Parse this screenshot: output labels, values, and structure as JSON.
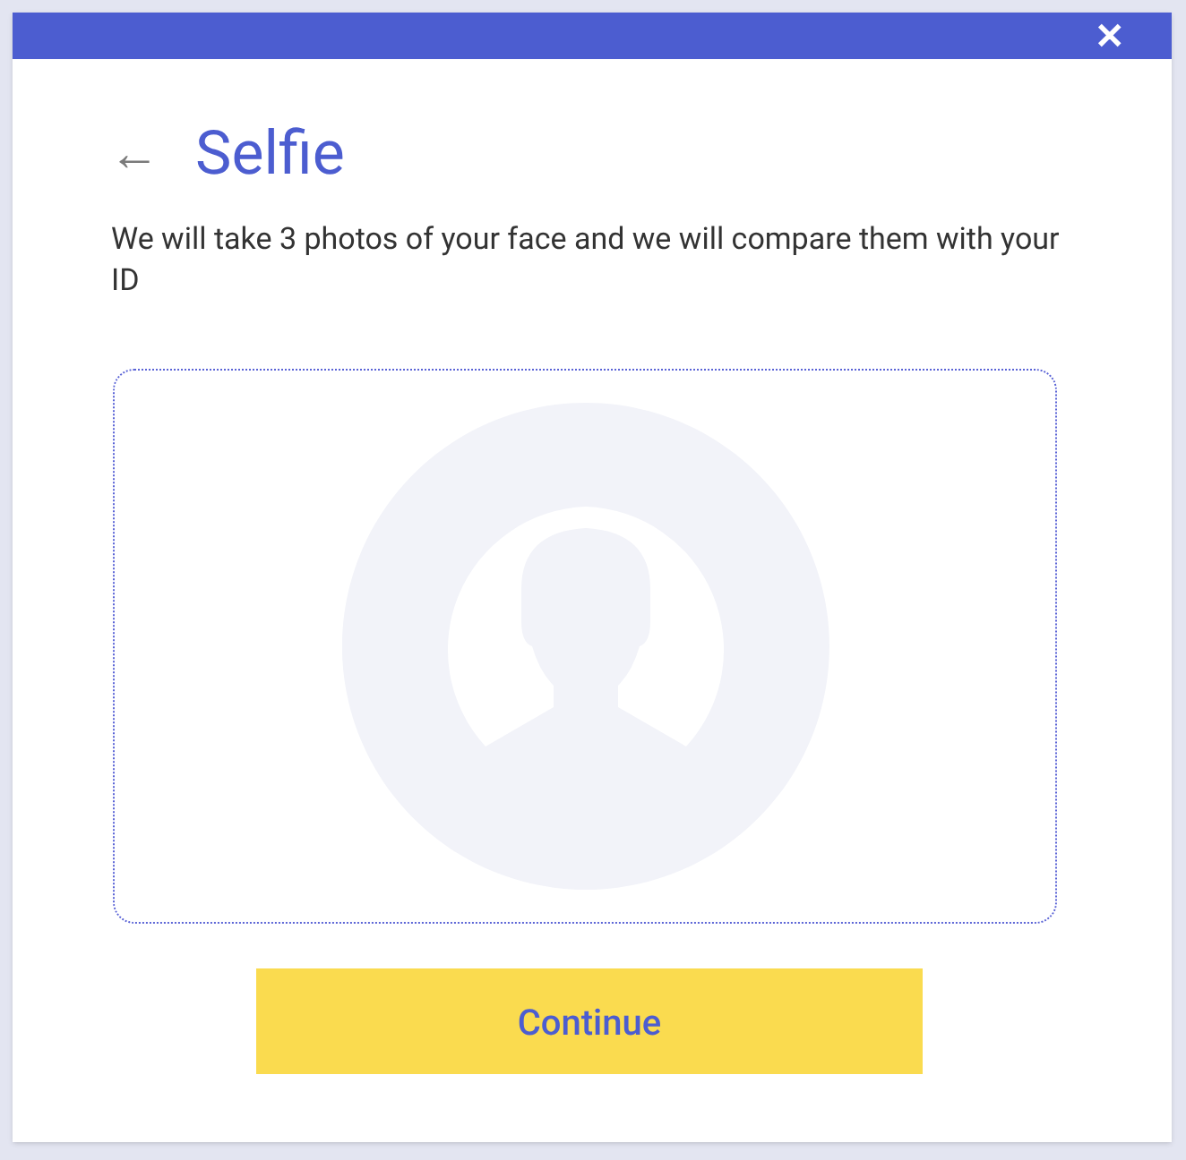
{
  "dialog": {
    "close": "✕"
  },
  "header": {
    "back": "←",
    "title": "Selfie"
  },
  "description": "We will take 3 photos of your face and we will compare them with your ID",
  "photo_area": {
    "kind": "placeholder"
  },
  "buttons": [
    "Continue"
  ]
}
